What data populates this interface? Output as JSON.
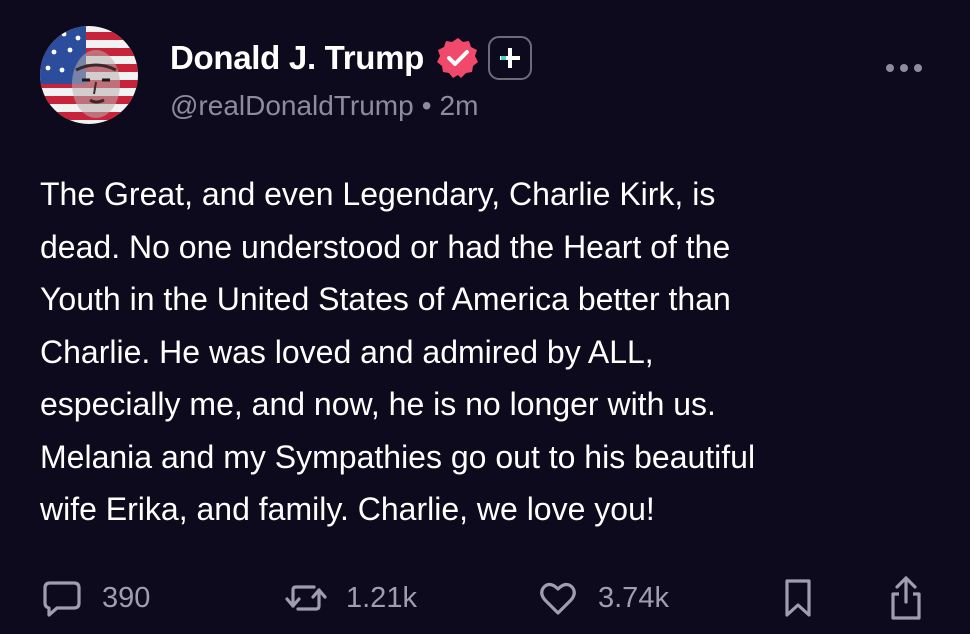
{
  "author": {
    "display_name": "Donald J. Trump",
    "handle": "@realDonaldTrump",
    "separator": "•",
    "timestamp": "2m",
    "verified_badge_color": "#f0496c",
    "avatar_icon": "flag-portrait-avatar"
  },
  "header": {
    "subscribe_icon": "plus-icon",
    "more_icon": "ellipsis-icon"
  },
  "post": {
    "text": "The Great, and even Legendary, Charlie Kirk, is\ndead. No one understood or had the Heart of the\nYouth in the United States of America better than\nCharlie. He was loved and admired by ALL,\nespecially me, and now, he is no longer with us.\nMelania and my Sympathies go out to his beautiful\nwife Erika, and family. Charlie, we love you!"
  },
  "actions": {
    "replies": {
      "icon": "comment-icon",
      "count": "390"
    },
    "reposts": {
      "icon": "repost-icon",
      "count": "1.21k"
    },
    "likes": {
      "icon": "heart-icon",
      "count": "3.74k"
    },
    "bookmark": {
      "icon": "bookmark-icon"
    },
    "share": {
      "icon": "share-icon"
    }
  },
  "colors": {
    "background": "#0c0a1c",
    "primary_text": "#ffffff",
    "secondary_text": "#8e8c9c",
    "icon": "#9f9daf"
  }
}
